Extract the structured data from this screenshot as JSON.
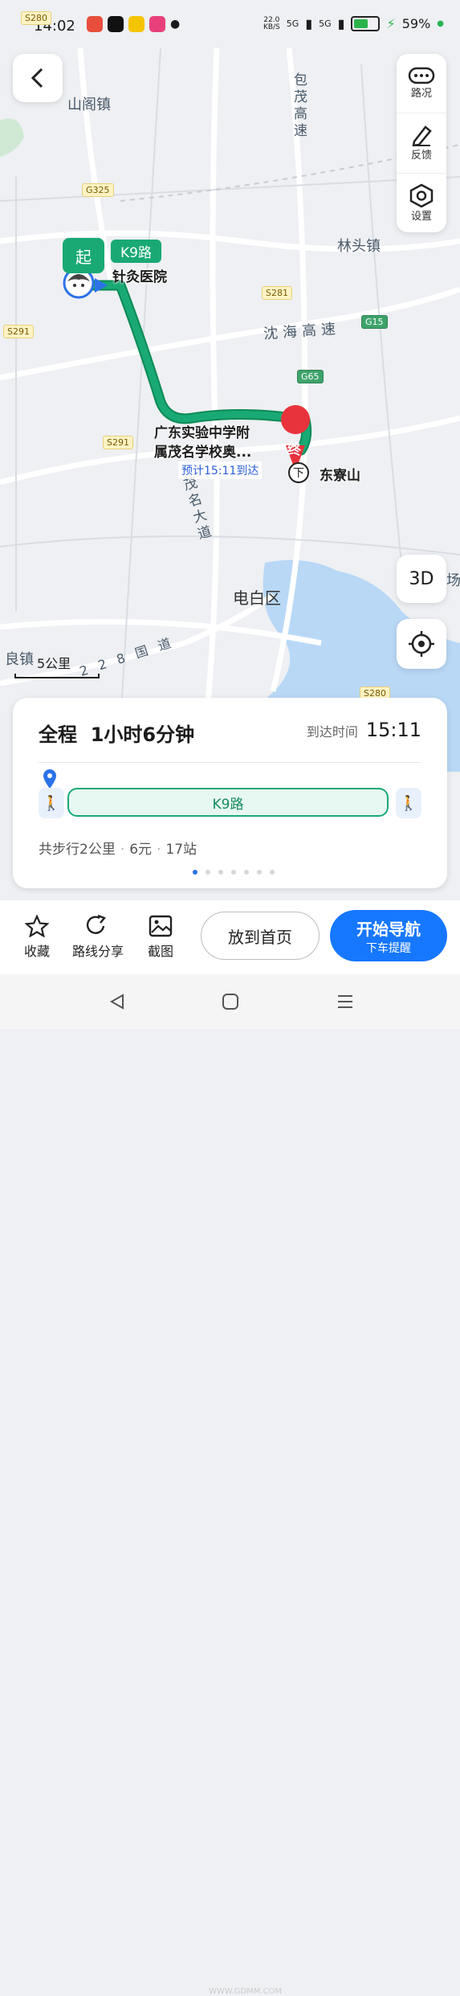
{
  "status_bar": {
    "time": "14:02",
    "net_speed_top": "22.0",
    "net_speed_unit": "KB/S",
    "signal_1": "5G",
    "signal_2": "5G",
    "battery": "59%"
  },
  "map": {
    "labels": {
      "shange_town": "山阁镇",
      "baomao_highway": "包茂高速",
      "lintou_town": "林头镇",
      "shenhai_highway": "沈海高速",
      "maoming_avenue": "茂名大道",
      "dianbai_district": "电白区",
      "liang_town": "良镇",
      "national_road": "228国道",
      "edge_text": "场"
    },
    "road_signs": {
      "s280_top": "S280",
      "g325": "G325",
      "s281": "S281",
      "s291_left": "S291",
      "g15": "G15",
      "g65": "G65",
      "s291_mid": "S291",
      "s280_bottom": "S280"
    },
    "start_marker": "起",
    "bus_line_tag": "K9路",
    "start_poi": "针灸医院",
    "mid_poi_line1": "广东实验中学附",
    "mid_poi_line2": "属茂名学校奥...",
    "eta_label": "预计15:11到达",
    "end_marker": "终",
    "alight_marker": "下",
    "end_poi": "东寮山",
    "scale_label": "5公里"
  },
  "right_tools": {
    "traffic": "路况",
    "feedback": "反馈",
    "settings": "设置"
  },
  "map_controls": {
    "three_d": "3D"
  },
  "route_panel": {
    "total_label": "全程",
    "duration": "1小时6分钟",
    "arrival_label": "到达时间",
    "arrival_time": "15:11",
    "bus_segment": "K9路",
    "walk_total": "共步行2公里",
    "fare": "6元",
    "stops": "17站",
    "page_count": 7,
    "active_page": 1
  },
  "bottom_actions": {
    "favorite": "收藏",
    "share": "路线分享",
    "screenshot": "截图",
    "home": "放到首页",
    "start_nav": "开始导航",
    "start_nav_sub": "下车提醒"
  },
  "colors": {
    "route_green": "#19a974",
    "accent_blue": "#1677ff",
    "end_red": "#e8333c",
    "water": "#b9d8f6"
  },
  "watermark": "WWW.GDMM.COM"
}
